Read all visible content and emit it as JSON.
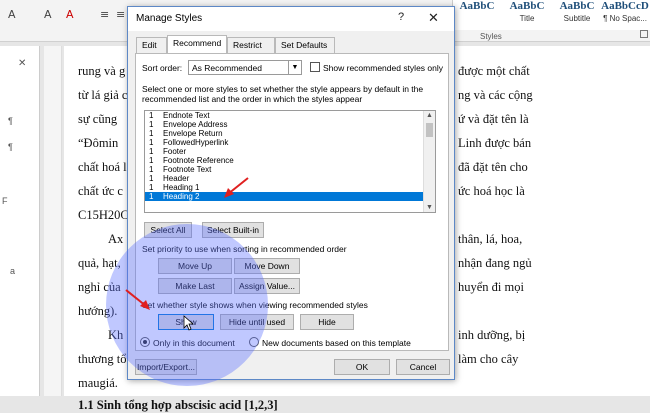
{
  "ribbon": {
    "tools": [
      "A",
      "A",
      "A"
    ],
    "style_gallery": [
      {
        "preview": "AaBbC",
        "name": ""
      },
      {
        "preview": "AaBbC",
        "name": "Title"
      },
      {
        "preview": "AaBbC",
        "name": "Subtitle"
      },
      {
        "preview": "AaBbCcD",
        "name": "¶ No Spac..."
      }
    ],
    "styles_group_label": "Styles"
  },
  "document": {
    "lines": [
      "rung và g",
      "từ lá giả c",
      "sự cũng",
      "“Đômin",
      "chất hoá l",
      "chất ức c",
      "C15H20C",
      "Ax",
      "quả, hạt,",
      "nghỉ của",
      "hướng).",
      "Kh",
      "thương tổ",
      "maugiá.",
      "1.1 Sinh tổng hợp abscisic acid [1,2,3]"
    ],
    "right_lines": [
      "được một chất",
      "ng và các cộng",
      "ứ và đặt tên là",
      "Linh được bán",
      "đã đặt tên cho",
      "ức hoá học là",
      "thân, lá, hoa,",
      "nhận đang ngủ",
      "huyển đi mọi",
      "inh dưỡng, bị",
      "làm cho cây"
    ]
  },
  "dialog": {
    "title": "Manage Styles",
    "help": "?",
    "close": "✕",
    "tabs": [
      "Edit",
      "Recommend",
      "Restrict",
      "Set Defaults"
    ],
    "active_tab": "Recommend",
    "sort_order_label": "Sort order:",
    "sort_order_value": "As Recommended",
    "show_recommended_only_label": "Show recommended styles only",
    "instructions": [
      "Select one or more styles to set whether the style appears by default in the",
      "recommended list and the order in which the styles appear"
    ],
    "styles_list": [
      {
        "num": "1",
        "name": "Endnote Text",
        "selected": false
      },
      {
        "num": "1",
        "name": "Envelope Address",
        "selected": false
      },
      {
        "num": "1",
        "name": "Envelope Return",
        "selected": false
      },
      {
        "num": "1",
        "name": "FollowedHyperlink",
        "selected": false
      },
      {
        "num": "1",
        "name": "Footer",
        "selected": false
      },
      {
        "num": "1",
        "name": "Footnote Reference",
        "selected": false
      },
      {
        "num": "1",
        "name": "Footnote Text",
        "selected": false
      },
      {
        "num": "1",
        "name": "Header",
        "selected": false
      },
      {
        "num": "1",
        "name": "Heading 1",
        "selected": false
      },
      {
        "num": "1",
        "name": "Heading 2",
        "selected": true
      }
    ],
    "select_all": "Select All",
    "select_builtin": "Select Built-in",
    "priority_label": "Set priority to use when sorting in recommended order",
    "move_up": "Move Up",
    "move_down": "Move Down",
    "make_last": "Make Last",
    "assign_value": "Assign Value...",
    "visibility_label": "Set whether style shows when viewing recommended styles",
    "show": "Show",
    "hide_until_used": "Hide until used",
    "hide": "Hide",
    "radio_only_this_doc": "Only in this document",
    "radio_new_docs": "New documents based on this template",
    "import_export": "Import/Export...",
    "ok": "OK",
    "cancel": "Cancel"
  },
  "colors": {
    "selection": "#0078d7",
    "highlight": "#5a6eff",
    "arrow": "#e02020"
  }
}
